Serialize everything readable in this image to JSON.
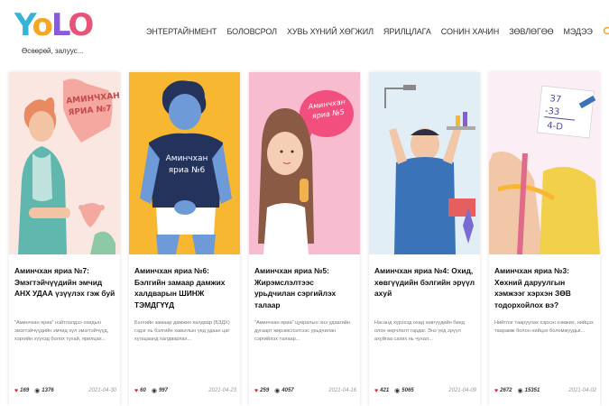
{
  "brand": {
    "logo": "YOLO",
    "tagline": "Өсөөрөй, залуус..."
  },
  "nav": {
    "items": [
      "ЭНТЕРТАЙНМЕНТ",
      "БОЛОВСРОЛ",
      "ХУВЬ ХҮНИЙ ХӨГЖИЛ",
      "ЯРИЛЦЛАГА",
      "СОНИН ХАЧИН",
      "ЗӨВЛӨГӨӨ",
      "МЭДЭЭ"
    ],
    "search_icon": "search-icon",
    "login_icon": "login-icon"
  },
  "accent": "#f6a623",
  "cards": [
    {
      "bg": "#fbe7e1",
      "image_text": "АМИНЧХАН ЯРИА №7",
      "title": "Аминчхан яриа №7: Эмэгтэйчүүдийн эмчид АНХ УДАА үзүүлэх гэж буй",
      "excerpt": "\"Аминчхан яриа\" нэйтлэлдээ охидын эмэгтэйчүүдийн эмчид хүл эмэгтэйчүүд, хэргийн хүүхэд болох тухай, ярилцах...",
      "likes": "169",
      "views": "1376",
      "date": "2021-04-30"
    },
    {
      "bg": "#f7b731",
      "image_text": "Аминчхан яриа №6",
      "title": "Аминчхан яриа №6: Бэлгийн замаар дамжих халдварын ШИНЖ ТЭМДГҮҮД",
      "excerpt": "Бэлгийн замаар дамжих халдвар (БЗДХ) гэдэг нь бэлгийн хавьтлын үед удаан цаг хугацаанд халдварлах...",
      "likes": "60",
      "views": "997",
      "date": "2021-04-23"
    },
    {
      "bg": "#f8bcd0",
      "image_text": "Аминчхан яриа №5",
      "title": "Аминчхан яриа №5: Жирэмслэлтээс урьдчилан сэргийлэх талаар",
      "excerpt": "\"Аминчхан яриа\" цувралын энэ удаагийн дугаарт жирэмслэлтээс урьдчилан сэргийлэх талаар...",
      "likes": "259",
      "views": "4057",
      "date": "2021-04-16"
    },
    {
      "bg": "#e3eef6",
      "image_text": "",
      "title": "Аминчхан яриа №4: Охид, хөвгүүдийн бэлгийн эрүүл ахуй",
      "excerpt": "Насанд хүрэхэд охид хөвгүүдийн биед олон өөрчлөлт гардаг. Энэ үед эрүүл ахуйгаа сахих нь чухал...",
      "likes": "421",
      "views": "5065",
      "date": "2021-04-09"
    },
    {
      "bg": "#fbeef5",
      "image_text": "",
      "title": "Аминчхан яриа №3: Хөхний даруулгын хэмжээг хэрхэн ЗӨВ тодорхойлох вэ?",
      "excerpt": "Нийтлэг тааруулах хэрхэн хэмжих, нийцэх таарамж болон нийцэх боломжуудыг...",
      "likes": "2672",
      "views": "15351",
      "date": "2021-04-02"
    }
  ]
}
